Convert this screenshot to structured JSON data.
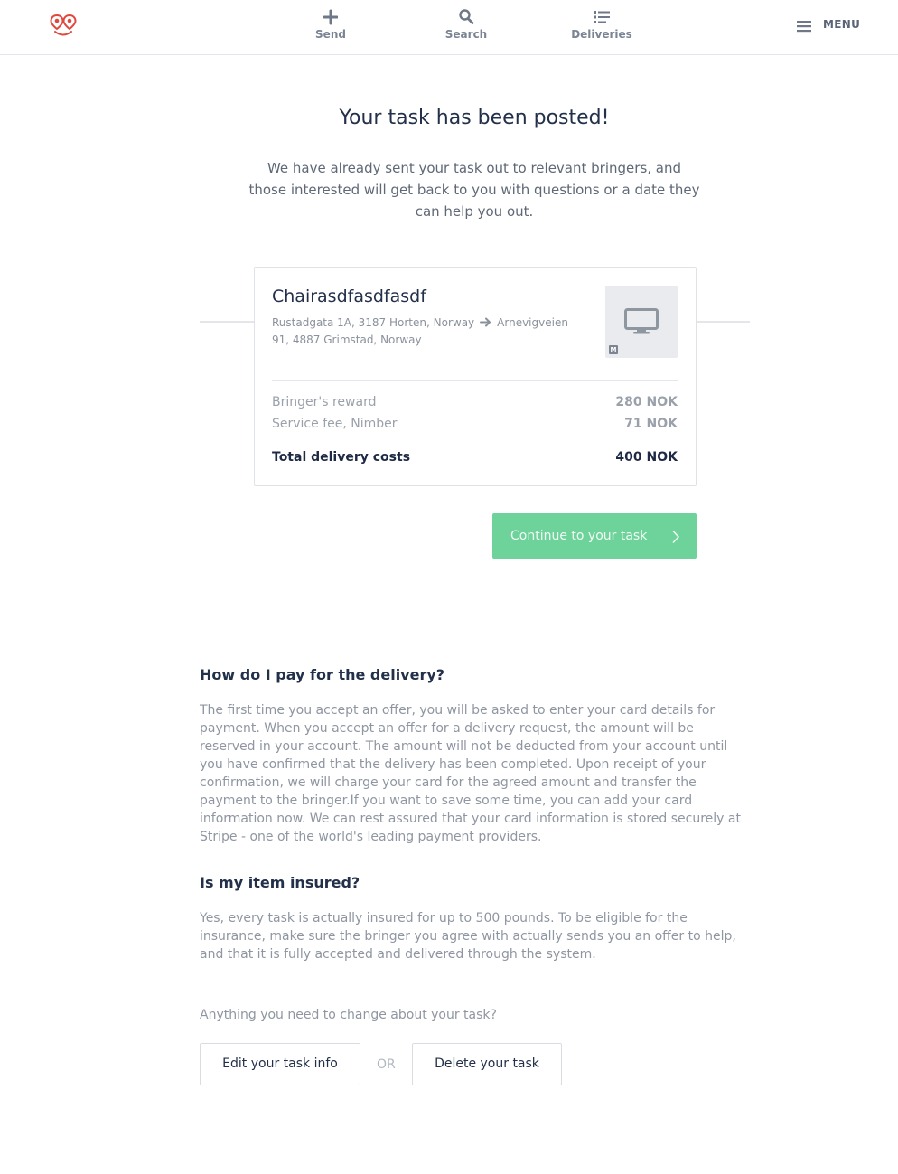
{
  "header": {
    "logo": "nimber-logo",
    "nav": [
      {
        "label": "Send",
        "icon": "plus-icon"
      },
      {
        "label": "Search",
        "icon": "search-icon"
      },
      {
        "label": "Deliveries",
        "icon": "list-icon"
      }
    ],
    "menu_label": "MENU"
  },
  "hero": {
    "title": "Your task has been posted!",
    "text": "We have already sent your task out to relevant bringers, and those interested will get back to you with questions or a date they can help you out."
  },
  "task": {
    "title": "Chairasdfasdfasdf",
    "from": "Rustadgata 1A, 3187 Horten, Norway",
    "to": "Arnevigveien 91, 4887 Grimstad, Norway",
    "size_badge": "M",
    "costs": {
      "reward_label": "Bringer's reward",
      "reward_value": "280 NOK",
      "fee_label": "Service fee, Nimber",
      "fee_value": "71 NOK",
      "total_label": "Total delivery costs",
      "total_value": "400 NOK"
    }
  },
  "cta": {
    "label": "Continue to your task"
  },
  "faq": [
    {
      "question": "How do I pay for the delivery?",
      "answer": "The first time you accept an offer, you will be asked to enter your card details for payment. When you accept an offer for a delivery request, the amount will be reserved in your account. The amount will not be deducted from your account until you have confirmed that the delivery has been completed. Upon receipt of your confirmation, we will charge your card for the agreed amount and transfer the payment to the bringer.If you want to save some time, you can add your card information now. We can rest assured that your card information is stored securely at Stripe - one of the world's leading payment providers."
    },
    {
      "question": "Is my item insured?",
      "answer": "Yes, every task is actually insured for up to 500 pounds. To be eligible for the insurance, make sure the bringer you agree with actually sends you an offer to help, and that it is fully accepted and delivered through the system."
    }
  ],
  "change": {
    "prompt": "Anything you need to change about your task?",
    "edit_label": "Edit your task info",
    "or_label": "OR",
    "delete_label": "Delete your task"
  },
  "colors": {
    "brand": "#e1483d",
    "cta": "#6ed39a",
    "text_dark": "#22304a",
    "text_muted": "#8f96a1"
  }
}
